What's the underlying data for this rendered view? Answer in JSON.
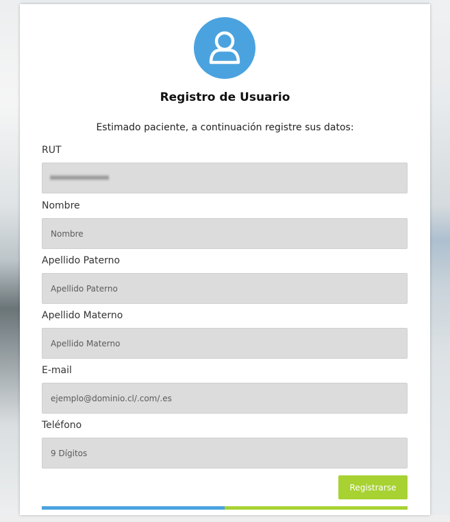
{
  "form": {
    "title": "Registro de Usuario",
    "subtitle": "Estimado paciente, a continuación registre sus datos:",
    "fields": [
      {
        "label": "RUT",
        "value": "",
        "placeholder": ""
      },
      {
        "label": "Nombre",
        "value": "",
        "placeholder": "Nombre"
      },
      {
        "label": "Apellido Paterno",
        "value": "",
        "placeholder": "Apellido Paterno"
      },
      {
        "label": "Apellido Materno",
        "value": "",
        "placeholder": "Apellido Materno"
      },
      {
        "label": "E-mail",
        "value": "",
        "placeholder": "ejemplo@dominio.cl/.com/.es"
      },
      {
        "label": "Teléfono",
        "value": "",
        "placeholder": "9 Dígitos"
      }
    ],
    "submit_label": "Registrarse"
  },
  "icons": {
    "avatar": "user-icon"
  },
  "colors": {
    "primary_blue": "#4aa3df",
    "accent_green": "#a7d232",
    "input_bg": "#dcdcdc"
  }
}
